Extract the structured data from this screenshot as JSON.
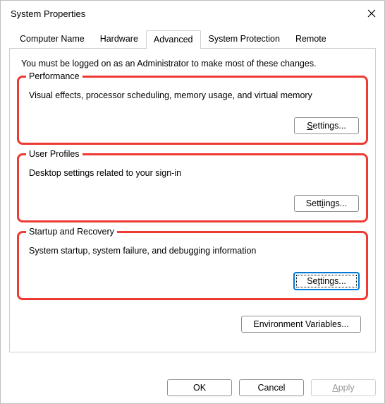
{
  "window": {
    "title": "System Properties"
  },
  "tabs": {
    "t0": "Computer Name",
    "t1": "Hardware",
    "t2": "Advanced",
    "t3": "System Protection",
    "t4": "Remote"
  },
  "intro": "You must be logged on as an Administrator to make most of these changes.",
  "groups": {
    "perf": {
      "legend": "Performance",
      "desc": "Visual effects, processor scheduling, memory usage, and virtual memory",
      "btn_pre": "S",
      "btn_post": "ettings..."
    },
    "profiles": {
      "legend": "User Profiles",
      "desc": "Desktop settings related to your sign-in",
      "btn_pre": "Sett",
      "btn_post": "ings..."
    },
    "startup": {
      "legend": "Startup and Recovery",
      "desc": "System startup, system failure, and debugging information",
      "btn_pre": "Se",
      "btn_post": "tings..."
    }
  },
  "env_button": "Environment Variables...",
  "footer": {
    "ok": "OK",
    "cancel": "Cancel",
    "apply": "Apply"
  }
}
